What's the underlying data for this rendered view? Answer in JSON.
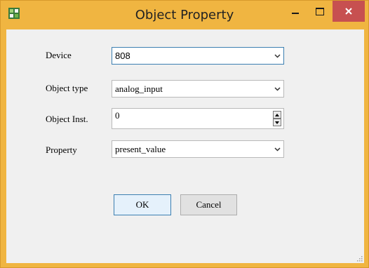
{
  "window": {
    "title": "Object Property",
    "icon": "app-icon",
    "controls": [
      "minimize-icon",
      "maximize-icon",
      "close-icon"
    ],
    "accent_color": "#f0b541",
    "close_color": "#c75050"
  },
  "form": {
    "device": {
      "label": "Device",
      "value": "808"
    },
    "object_type": {
      "label": "Object type",
      "value": "analog_input"
    },
    "object_inst": {
      "label": "Object Inst.",
      "value": "0"
    },
    "property": {
      "label": "Property",
      "value": "present_value"
    }
  },
  "buttons": {
    "ok": "OK",
    "cancel": "Cancel"
  }
}
